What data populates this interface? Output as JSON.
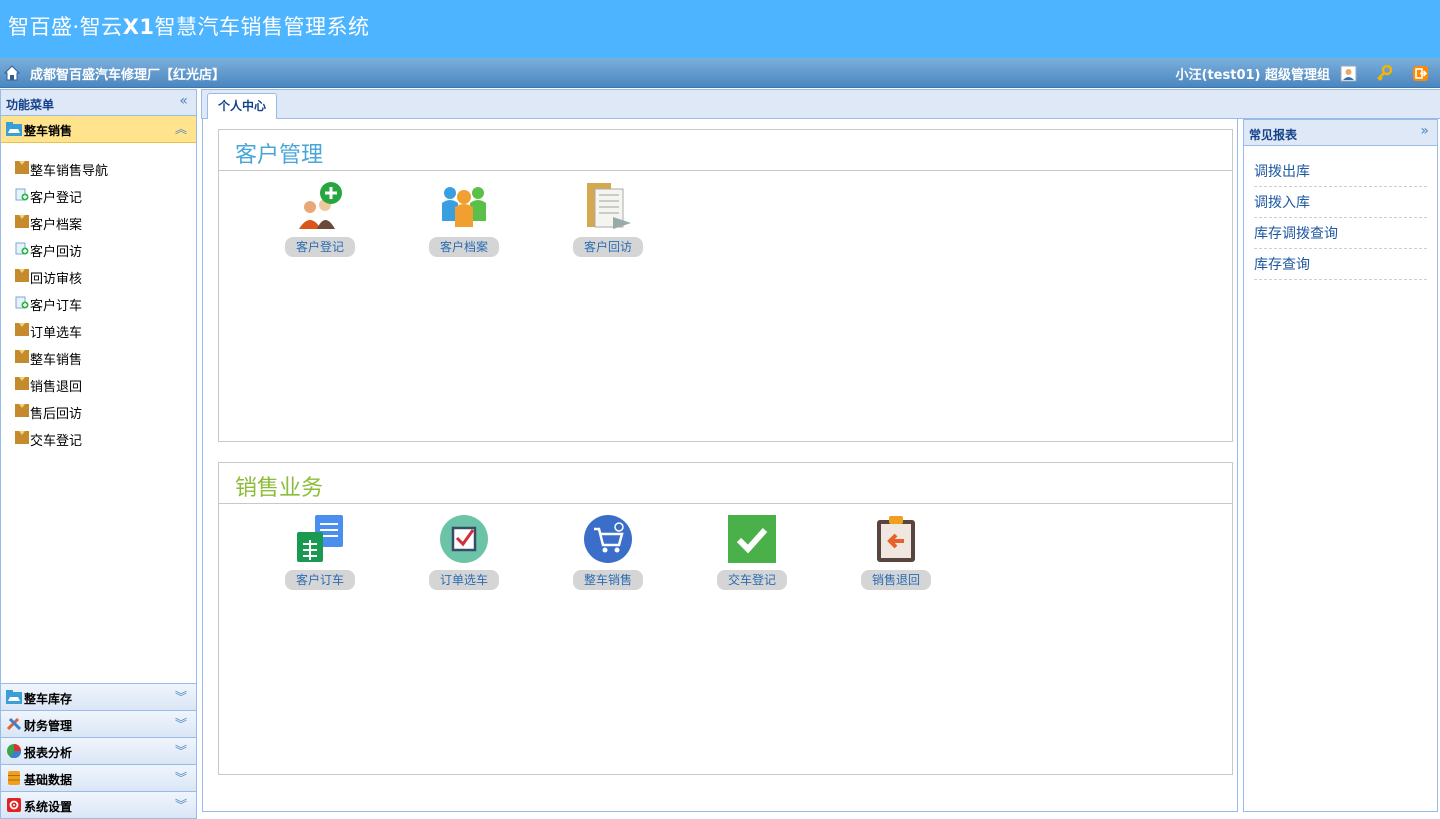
{
  "header": {
    "title_prefix": "智百盛·智云",
    "title_bold": "X1",
    "title_suffix": "智慧汽车销售管理系统",
    "org_name": "成都智百盛汽车修理厂【红光店】",
    "user": "小汪(test01)  超级管理组",
    "colors": {
      "banner": "#4db5ff",
      "orgbar": "#4a86c0"
    }
  },
  "sidebar": {
    "title": "功能菜单",
    "active_section": {
      "label": "整车销售",
      "icon": "car-folder-icon"
    },
    "items": [
      {
        "label": "整车销售导航",
        "icon": "folder-icon"
      },
      {
        "label": "客户登记",
        "icon": "add-doc-icon"
      },
      {
        "label": "客户档案",
        "icon": "folder-icon"
      },
      {
        "label": "客户回访",
        "icon": "add-doc-icon"
      },
      {
        "label": "回访审核",
        "icon": "folder-icon"
      },
      {
        "label": "客户订车",
        "icon": "add-doc-icon"
      },
      {
        "label": "订单选车",
        "icon": "folder-icon"
      },
      {
        "label": "整车销售",
        "icon": "folder-icon"
      },
      {
        "label": "销售退回",
        "icon": "folder-icon"
      },
      {
        "label": "售后回访",
        "icon": "folder-icon"
      },
      {
        "label": "交车登记",
        "icon": "folder-icon"
      }
    ],
    "sections": [
      {
        "label": "整车库存",
        "icon": "car-folder-icon"
      },
      {
        "label": "财务管理",
        "icon": "tools-icon"
      },
      {
        "label": "报表分析",
        "icon": "pie-chart-icon"
      },
      {
        "label": "基础数据",
        "icon": "database-icon"
      },
      {
        "label": "系统设置",
        "icon": "settings-icon"
      }
    ]
  },
  "tabs": [
    {
      "label": "个人中心"
    }
  ],
  "panels": [
    {
      "title": "客户管理",
      "tiles": [
        {
          "label": "客户登记",
          "icon": "add-person-icon"
        },
        {
          "label": "客户档案",
          "icon": "people-group-icon"
        },
        {
          "label": "客户回访",
          "icon": "file-folder-icon"
        }
      ]
    },
    {
      "title": "销售业务",
      "tiles": [
        {
          "label": "客户订车",
          "icon": "documents-icon"
        },
        {
          "label": "订单选车",
          "icon": "checkbox-icon"
        },
        {
          "label": "整车销售",
          "icon": "shopping-cart-icon"
        },
        {
          "label": "交车登记",
          "icon": "checkmark-icon"
        },
        {
          "label": "销售退回",
          "icon": "clipboard-return-icon"
        }
      ]
    }
  ],
  "right_panel": {
    "title": "常见报表",
    "items": [
      "调拨出库",
      "调拨入库",
      "库存调拨查询",
      "库存查询"
    ]
  }
}
